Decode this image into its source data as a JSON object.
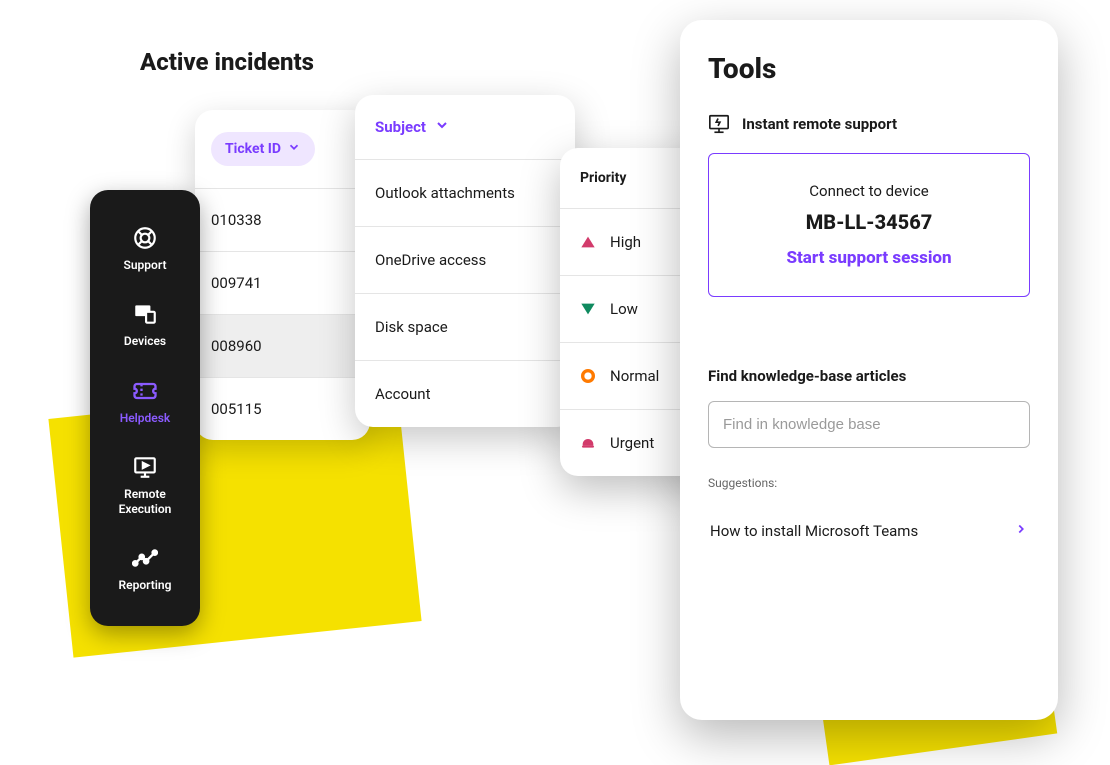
{
  "section_title": "Active incidents",
  "sidebar": {
    "items": [
      {
        "label": "Support"
      },
      {
        "label": "Devices"
      },
      {
        "label": "Helpdesk"
      },
      {
        "label": "Remote Execution"
      },
      {
        "label": "Reporting"
      }
    ]
  },
  "ticket": {
    "header": "Ticket ID",
    "rows": [
      "010338",
      "009741",
      "008960",
      "005115"
    ],
    "selected_index": 2
  },
  "subject": {
    "header": "Subject",
    "rows": [
      "Outlook attachments",
      "OneDrive access",
      "Disk space",
      "Account"
    ]
  },
  "priority": {
    "header": "Priority",
    "rows": [
      {
        "label": "High"
      },
      {
        "label": "Low"
      },
      {
        "label": "Normal"
      },
      {
        "label": "Urgent"
      }
    ]
  },
  "tools": {
    "title": "Tools",
    "remote_support_label": "Instant remote support",
    "connect_label": "Connect to device",
    "device_name": "MB-LL-34567",
    "start_session_label": "Start support session",
    "kb_label": "Find knowledge-base articles",
    "kb_placeholder": "Find in knowledge base",
    "suggestions_label": "Suggestions:",
    "suggestion_1": "How to install Microsoft Teams"
  }
}
